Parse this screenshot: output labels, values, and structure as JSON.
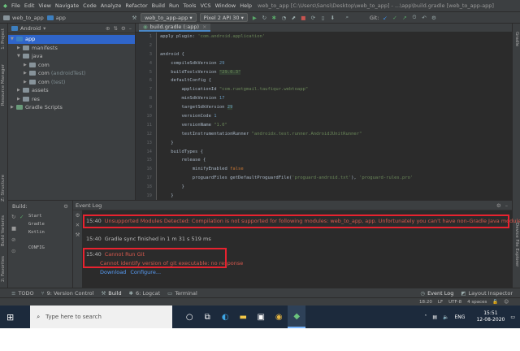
{
  "menubar": {
    "items": [
      "File",
      "Edit",
      "View",
      "Navigate",
      "Code",
      "Analyze",
      "Refactor",
      "Build",
      "Run",
      "Tools",
      "VCS",
      "Window",
      "Help"
    ],
    "window_title": "web_to_app [C:\\Users\\Sansi\\Desktop\\web_to_app] - ...\\app\\build.gradle [web_to_app-app]"
  },
  "toolbar": {
    "crumb_project": "web_to_app",
    "crumb_module": "app",
    "run_config": "web_to_app-app",
    "device": "Pixel 2 API 30",
    "git_label": "Git:"
  },
  "left_strip": {
    "project": "1: Project",
    "resource_manager": "Resource Manager",
    "structure": "Z: Structure",
    "build_variants": "Build Variants",
    "favorites": "2: Favorites"
  },
  "right_strip": {
    "gradle": "Gradle",
    "device_explorer": "Device File Explorer"
  },
  "project_panel": {
    "view_label": "Android",
    "nodes": [
      {
        "label": "app",
        "muted": ""
      },
      {
        "label": "manifests",
        "muted": ""
      },
      {
        "label": "java",
        "muted": ""
      },
      {
        "label": "com",
        "muted": ""
      },
      {
        "label": "com",
        "muted": "(androidTest)"
      },
      {
        "label": "com",
        "muted": "(test)"
      },
      {
        "label": "assets",
        "muted": ""
      },
      {
        "label": "res",
        "muted": ""
      },
      {
        "label": "Gradle Scripts",
        "muted": ""
      }
    ]
  },
  "editor": {
    "tab": "build.gradle (:app)",
    "line_numbers": [
      "1",
      "2",
      "3",
      "4",
      "5",
      "6",
      "7",
      "8",
      "9",
      "10",
      "11",
      "12",
      "13",
      "14",
      "15",
      "16",
      "17",
      "18",
      "19"
    ],
    "code": {
      "l1a": "apply plugin: ",
      "l1b": "'com.android.application'",
      "l3": "android {",
      "l4a": "    compileSdkVersion ",
      "l4b": "29",
      "l5a": "    buildToolsVersion ",
      "l5b": "\"29.0.3\"",
      "l6": "    defaultConfig {",
      "l7a": "        applicationId ",
      "l7b": "\"com.ruetgmail.taufiqur.webtoapp\"",
      "l8a": "        minSdkVersion ",
      "l8b": "17",
      "l9a": "        targetSdkVersion ",
      "l9b": "29",
      "l10a": "        versionCode ",
      "l10b": "1",
      "l11a": "        versionName ",
      "l11b": "\"1.0\"",
      "l12a": "        testInstrumentationRunner ",
      "l12b": "\"androidx.test.runner.AndroidJUnitRunner\"",
      "l13": "    }",
      "l14": "    buildTypes {",
      "l15": "        release {",
      "l16a": "            minifyEnabled ",
      "l16b": "false",
      "l17a": "            proguardFiles getDefaultProguardFile(",
      "l17b": "'proguard-android.txt'",
      "l17c": "), ",
      "l17d": "'proguard-rules.pro'",
      "l18": "        }",
      "l19": "    }"
    }
  },
  "build_panel": {
    "title": "Build:",
    "lines": [
      "Start",
      "Gradle",
      "Kotlin",
      "CONFIG"
    ]
  },
  "event_log": {
    "title": "Event Log",
    "e1_time": "15:40",
    "e1_text": "Unsupported Modules Detected: Compilation is not supported for following modules: web_to_app, app. Unfortunately you can't have non-Gradle Java modules and Android-Gradle modules",
    "e2_time": "15:40",
    "e2_text": "Gradle sync finished in 1 m 31 s 519 ms",
    "e3_time": "15:40",
    "e3_title": "Cannot Run Git",
    "e3_detail": "Cannot identify version of git executable: no response",
    "e3_link1": "Download",
    "e3_link2": "Configure..."
  },
  "bottom_tabs": {
    "todo": "TODO",
    "vcs": "9: Version Control",
    "build": "Build",
    "logcat": "6: Logcat",
    "terminal": "Terminal",
    "event_log": "Event Log",
    "layout_inspector": "Layout Inspector"
  },
  "statusbar": {
    "pos": "18:20",
    "ending": "LF",
    "encoding": "UTF-8",
    "indent": "4 spaces"
  },
  "taskbar": {
    "search_placeholder": "Type here to search",
    "lang": "ENG",
    "time": "15:51",
    "date": "12-08-2020"
  }
}
